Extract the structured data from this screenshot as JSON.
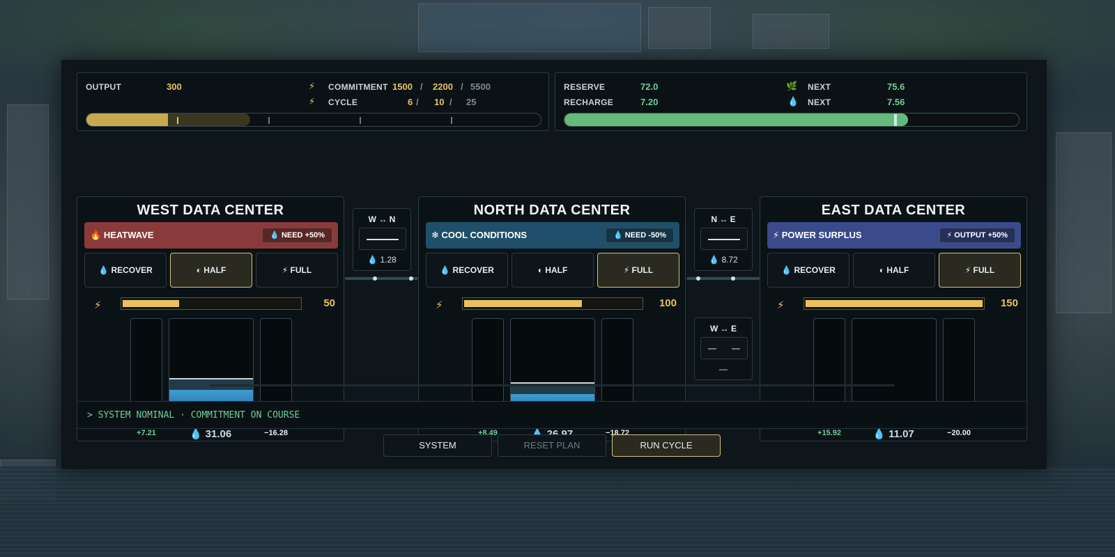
{
  "colors": {
    "accent_gold": "#e8c25c",
    "accent_green": "#6fcf97",
    "water_blue": "#3d9dd6",
    "heatwave": "#8a3a3a",
    "cool": "#1f4f6a",
    "surplus": "#3a4a8a"
  },
  "output": {
    "label": "OUTPUT",
    "value": "300",
    "progress": 0.18,
    "marker": 0.2
  },
  "commitment": {
    "icon": "bolt-icon",
    "label": "COMMITMENT",
    "current": "1500",
    "sep1": "/",
    "target": "2200",
    "sep2": "/",
    "max": "5500"
  },
  "cycle": {
    "icon": "bolt-icon",
    "label": "CYCLE",
    "current": "6",
    "sep1": "/",
    "target": "10",
    "sep2": "/",
    "max": "25"
  },
  "reserve": {
    "label": "RESERVE",
    "value": "72.0",
    "next_icon": "leaf-icon",
    "next_label": "NEXT",
    "next_value": "75.6",
    "progress": 0.756,
    "marker": 0.72
  },
  "recharge": {
    "label": "RECHARGE",
    "value": "7.20",
    "next_icon": "droplet-icon",
    "next_label": "NEXT",
    "next_value": "7.56"
  },
  "centers": [
    {
      "title": "WEST DATA CENTER",
      "condition_icon": "flame-icon",
      "condition": "HEATWAVE",
      "condition_glyph": "🔥",
      "badge": "💧 NEED +50%",
      "modes": [
        "💧  RECOVER",
        "◐  HALF",
        "⚡  FULL"
      ],
      "selected_mode": 1,
      "power": "50",
      "power_level": 0.33,
      "left_delta": "+7.21",
      "water": "💧  31.06",
      "right_delta": "−16.28",
      "left_level": 0.07,
      "center_level": 0.31,
      "center_prev": 0.41,
      "right_level": 0.17
    },
    {
      "title": "NORTH DATA CENTER",
      "condition_icon": "snowflake-icon",
      "condition": "COOL CONDITIONS",
      "condition_glyph": "❄",
      "badge": "💧 NEED -50%",
      "modes": [
        "💧  RECOVER",
        "◐  HALF",
        "⚡  FULL"
      ],
      "selected_mode": 2,
      "power": "100",
      "power_level": 0.67,
      "left_delta": "+8.49",
      "water": "💧  26.97",
      "right_delta": "−18.72",
      "left_level": 0.08,
      "center_level": 0.27,
      "center_prev": 0.37,
      "right_level": 0.19
    },
    {
      "title": "EAST DATA CENTER",
      "condition_icon": "bolt-icon",
      "condition": "POWER SURPLUS",
      "condition_glyph": "⚡",
      "badge": "⚡ OUTPUT +50%",
      "modes": [
        "💧  RECOVER",
        "◐  HALF",
        "⚡  FULL"
      ],
      "selected_mode": 2,
      "power": "150",
      "power_level": 1.0,
      "left_delta": "+15.92",
      "water": "💧  11.07",
      "right_delta": "−20.00",
      "left_level": 0.16,
      "center_level": 0.11,
      "center_prev": 0.16,
      "right_level": 0.2
    }
  ],
  "links": [
    {
      "title": "W ↔ N",
      "value": "💧  1.28"
    },
    {
      "title": "N ↔ E",
      "value": "💧  8.72"
    },
    {
      "title": "W ↔ E",
      "value": "—"
    }
  ],
  "console": {
    "message": "> SYSTEM NOMINAL · COMMITMENT ON COURSE"
  },
  "actions": {
    "system": "SYSTEM",
    "reset": "RESET PLAN",
    "run": "RUN CYCLE"
  }
}
